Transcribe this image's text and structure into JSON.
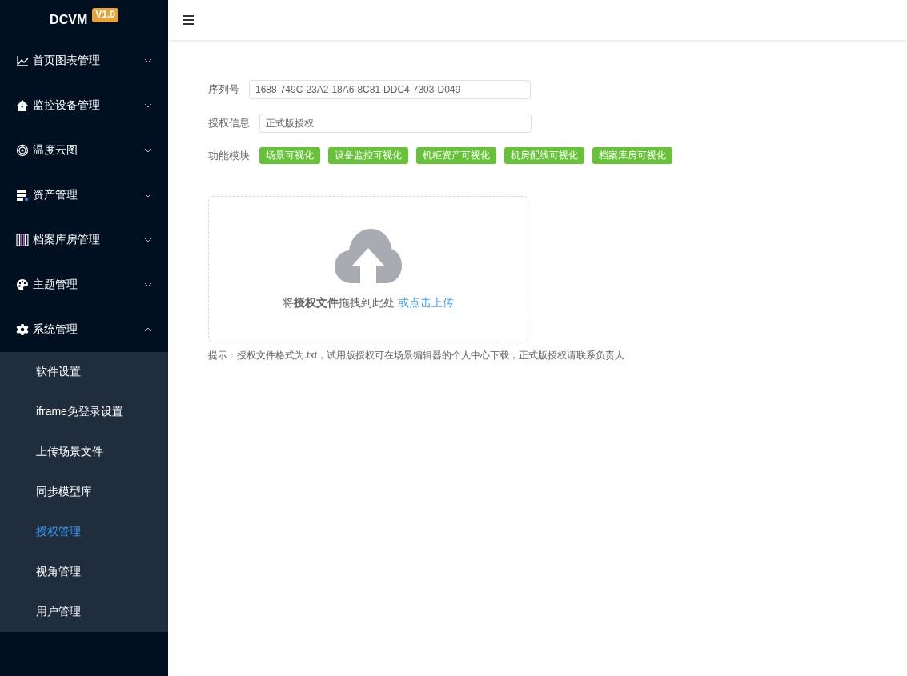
{
  "brand": {
    "name": "DCVM",
    "version": "V1.0"
  },
  "sidebar": {
    "items": [
      {
        "label": "首页图表管理",
        "expanded": false
      },
      {
        "label": "监控设备管理",
        "expanded": false
      },
      {
        "label": "温度云图",
        "expanded": false
      },
      {
        "label": "资产管理",
        "expanded": false
      },
      {
        "label": "档案库房管理",
        "expanded": false
      },
      {
        "label": "主题管理",
        "expanded": false
      },
      {
        "label": "系统管理",
        "expanded": true,
        "children": [
          {
            "label": "软件设置",
            "selected": false
          },
          {
            "label": "iframe免登录设置",
            "selected": false
          },
          {
            "label": "上传场景文件",
            "selected": false
          },
          {
            "label": "同步模型库",
            "selected": false
          },
          {
            "label": "授权管理",
            "selected": true
          },
          {
            "label": "视角管理",
            "selected": false
          },
          {
            "label": "用户管理",
            "selected": false
          }
        ]
      }
    ]
  },
  "form": {
    "serial": {
      "label": "序列号",
      "value": "1688-749C-23A2-18A6-8C81-DDC4-7303-D049"
    },
    "license": {
      "label": "授权信息",
      "value": "正式版授权"
    },
    "modules": {
      "label": "功能模块",
      "tags": [
        "场景可视化",
        "设备监控可视化",
        "机柜资产可视化",
        "机房配线可视化",
        "档案库房可视化"
      ]
    }
  },
  "upload": {
    "text": "将**授权文件**拖拽到此处",
    "link": "或点击上传"
  },
  "hint": "提示：授权文件格式为.txt，试用版授权可在场景编辑器的个人中心下载，正式版授权请联系负责人"
}
